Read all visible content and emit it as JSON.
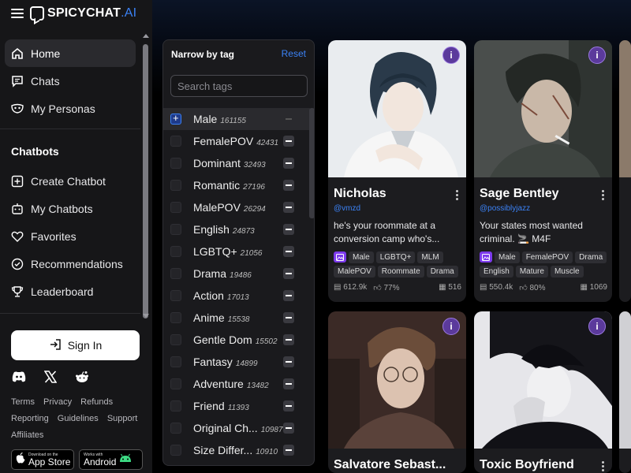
{
  "brand": {
    "name": "SPICYCHAT",
    "suffix": ".AI"
  },
  "nav": [
    {
      "label": "Home",
      "icon": "home-icon",
      "active": true
    },
    {
      "label": "Chats",
      "icon": "chat-icon"
    },
    {
      "label": "My Personas",
      "icon": "mask-icon"
    }
  ],
  "chatbots_section": {
    "title": "Chatbots",
    "items": [
      {
        "label": "Create Chatbot",
        "icon": "plus-square-icon"
      },
      {
        "label": "My Chatbots",
        "icon": "robot-icon"
      },
      {
        "label": "Favorites",
        "icon": "heart-icon"
      },
      {
        "label": "Recommendations",
        "icon": "check-circle-icon"
      },
      {
        "label": "Leaderboard",
        "icon": "trophy-icon"
      }
    ]
  },
  "signin": {
    "label": "Sign In"
  },
  "footer_links": {
    "row1": [
      "Terms",
      "Privacy",
      "Refunds"
    ],
    "row2": [
      "Reporting",
      "Guidelines",
      "Support"
    ],
    "row3": [
      "Affiliates"
    ]
  },
  "badges": {
    "appstore": {
      "small": "Download on the",
      "big": "App Store"
    },
    "android": {
      "small": "Works with",
      "big": "Android"
    }
  },
  "tag_panel": {
    "title": "Narrow by tag",
    "reset": "Reset",
    "search_placeholder": "Search tags",
    "tags": [
      {
        "name": "Male",
        "count": "161155",
        "selected": true
      },
      {
        "name": "FemalePOV",
        "count": "42431"
      },
      {
        "name": "Dominant",
        "count": "32493"
      },
      {
        "name": "Romantic",
        "count": "27196"
      },
      {
        "name": "MalePOV",
        "count": "26294"
      },
      {
        "name": "English",
        "count": "24873"
      },
      {
        "name": "LGBTQ+",
        "count": "21056"
      },
      {
        "name": "Drama",
        "count": "19486"
      },
      {
        "name": "Action",
        "count": "17013"
      },
      {
        "name": "Anime",
        "count": "15538"
      },
      {
        "name": "Gentle Dom",
        "count": "15502"
      },
      {
        "name": "Fantasy",
        "count": "14899"
      },
      {
        "name": "Adventure",
        "count": "13482"
      },
      {
        "name": "Friend",
        "count": "11393"
      },
      {
        "name": "Original Ch...",
        "count": "10987"
      },
      {
        "name": "Size Differ...",
        "count": "10910"
      }
    ]
  },
  "cards": [
    {
      "name": "Nicholas",
      "handle": "@vmzd",
      "desc": "he's your roommate at a conversion camp who's...",
      "tags": [
        "Male",
        "LGBTQ+",
        "MLM",
        "MalePOV",
        "Roommate",
        "Drama"
      ],
      "messages": "612.9k",
      "rating": "77%",
      "chats": "516"
    },
    {
      "name": "Sage Bentley",
      "handle": "@possiblyjazz",
      "desc": "Your states most wanted criminal. 🚬 M4F",
      "tags": [
        "Male",
        "FemalePOV",
        "Drama",
        "English",
        "Mature",
        "Muscle"
      ],
      "messages": "550.4k",
      "rating": "80%",
      "chats": "1069"
    },
    {
      "name": "Salvatore Sebast...",
      "handle": "",
      "desc": "",
      "tags": [],
      "messages": "",
      "rating": "",
      "chats": ""
    },
    {
      "name": "Toxic Boyfriend",
      "handle": "",
      "desc": "",
      "tags": [],
      "messages": "",
      "rating": "",
      "chats": ""
    }
  ]
}
